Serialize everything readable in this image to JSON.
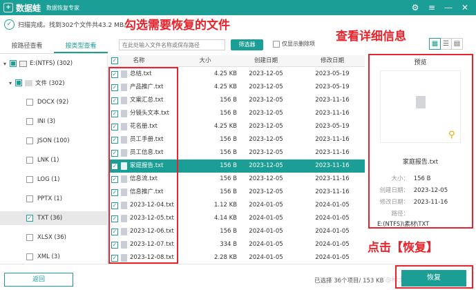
{
  "app": {
    "logo_glyph": "+",
    "name": "数据蛙",
    "subtitle": "数据恢复专家",
    "window_controls": [
      "⚙",
      "≡",
      "—",
      "✕"
    ]
  },
  "status": {
    "text": "扫描完成。找到302个文件共43.2 MB。"
  },
  "tabs": [
    {
      "label": "按路径查看",
      "active": false
    },
    {
      "label": "按类型查看",
      "active": true
    }
  ],
  "toolbar": {
    "search_placeholder": "在此处输入文件名称或保存路径",
    "filter_label": "筛选器",
    "show_deleted_label": "仅显示删除项"
  },
  "tree": {
    "drive": "E:(NTFS) (302)",
    "folder": "文件 (302)",
    "types": [
      {
        "label": "DOCX (92)",
        "checked": false
      },
      {
        "label": "INI (3)",
        "checked": false
      },
      {
        "label": "JSON (100)",
        "checked": false
      },
      {
        "label": "LNK (1)",
        "checked": false
      },
      {
        "label": "LOG (1)",
        "checked": false
      },
      {
        "label": "PPTX (1)",
        "checked": false
      },
      {
        "label": "TXT (36)",
        "checked": true
      },
      {
        "label": "XLSX (36)",
        "checked": false
      },
      {
        "label": "XML (3)",
        "checked": false
      }
    ]
  },
  "table": {
    "columns": [
      "名称",
      "大小",
      "创建日期",
      "修改日期"
    ],
    "rows": [
      {
        "name": "总结.txt",
        "size": "4.25 KB",
        "created": "2023-12-05",
        "modified": "2023-05-19"
      },
      {
        "name": "产品推广.txt",
        "size": "4.25 KB",
        "created": "2023-12-05",
        "modified": "2023-05-19"
      },
      {
        "name": "文案汇总.txt",
        "size": "156  B",
        "created": "2023-12-05",
        "modified": "2023-11-16"
      },
      {
        "name": "分镜头文本.txt",
        "size": "156  B",
        "created": "2023-12-05",
        "modified": "2023-11-16"
      },
      {
        "name": "花名册.txt",
        "size": "4.25 KB",
        "created": "2023-12-05",
        "modified": "2023-05-19"
      },
      {
        "name": "员工手册.txt",
        "size": "156  B",
        "created": "2023-12-05",
        "modified": "2023-11-16"
      },
      {
        "name": "员工信息.txt",
        "size": "156  B",
        "created": "2023-12-05",
        "modified": "2023-11-16"
      },
      {
        "name": "家庭报告.txt",
        "size": "156  B",
        "created": "2023-12-05",
        "modified": "2023-11-16"
      },
      {
        "name": "信息流.txt",
        "size": "156  B",
        "created": "2023-12-05",
        "modified": "2023-11-16"
      },
      {
        "name": "信息推广.txt",
        "size": "156  B",
        "created": "2023-12-05",
        "modified": "2023-11-16"
      },
      {
        "name": "2023-12-04.txt",
        "size": "1.12 KB",
        "created": "2024-01-05",
        "modified": "2024-01-05"
      },
      {
        "name": "2023-12-05.txt",
        "size": "4.14 KB",
        "created": "2024-01-05",
        "modified": "2024-01-05"
      },
      {
        "name": "2023-12-06.txt",
        "size": "156  B",
        "created": "2024-01-05",
        "modified": "2024-01-05"
      },
      {
        "name": "2023-12-07.txt",
        "size": "334  B",
        "created": "2024-01-05",
        "modified": "2024-01-05"
      },
      {
        "name": "2023-12-08.txt",
        "size": "2.28 KB",
        "created": "2024-01-05",
        "modified": "2024-01-05"
      }
    ]
  },
  "preview": {
    "title": "预览",
    "filename": "家庭报告.txt",
    "size_label": "大小：",
    "size": "156  B",
    "created_label": "创建日期：",
    "created": "2023-12-05",
    "modified_label": "修改日期：",
    "modified": "2023-11-16",
    "path_label": "路径：",
    "path": "E:(NTFS)\\素材\\TXT"
  },
  "bottom": {
    "back_label": "返回",
    "selected_info": "已选择 36个项目/ 153 KB",
    "recover_label": "恢复",
    "watermark": "@稀土掘金技术社区"
  },
  "annotations": {
    "select_files": "勾选需要恢复的文件",
    "view_details": "查看详细信息",
    "click_recover": "点击【恢复】"
  },
  "colors": {
    "accent": "#1b9e95",
    "annotation_red": "#e8232b"
  }
}
